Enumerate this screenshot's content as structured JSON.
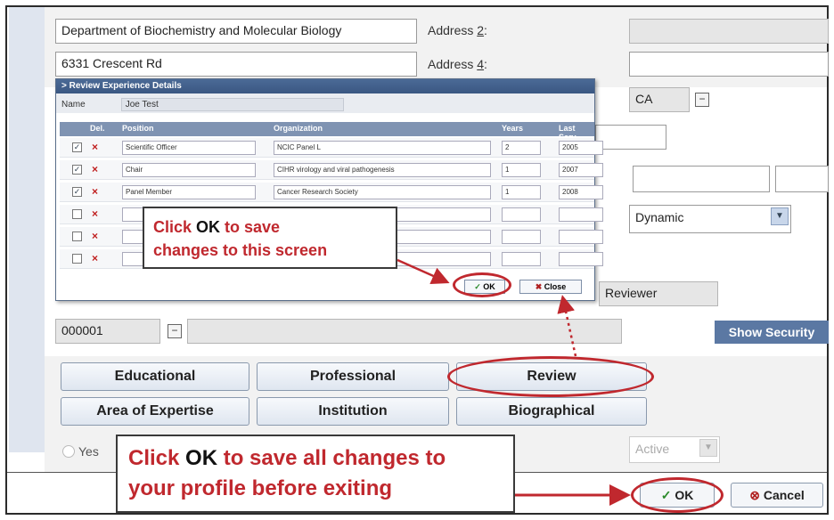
{
  "form": {
    "department": "Department of Biochemistry and Molecular Biology",
    "street": "6331 Crescent Rd",
    "address2_label_text": "Address ",
    "address2_label_key": "2",
    "address2_colon": ":",
    "address4_label_text": "Address ",
    "address4_label_key": "4",
    "address4_colon": ":",
    "province": "CA",
    "dropdown_value": "Dynamic",
    "reviewer_field": "Reviewer",
    "id_value": "000001",
    "show_security": "Show Security",
    "yes_label": "Yes",
    "status_value": "Active"
  },
  "tabs": {
    "educational": "Educational",
    "professional": "Professional",
    "review": "Review",
    "area": "Area of Expertise",
    "institution": "Institution",
    "biographical": "Biographical"
  },
  "popup": {
    "title": "Review Experience Details",
    "name_label": "Name",
    "name_value": "Joe Test",
    "headers": {
      "del": "Del.",
      "position": "Position",
      "organization": "Organization",
      "years": "Years",
      "last": "Last Serv"
    },
    "rows": [
      {
        "checked": "✓",
        "position": "Scientific Officer",
        "organization": "NCIC Panel L",
        "years": "2",
        "last": "2005"
      },
      {
        "checked": "✓",
        "position": "Chair",
        "organization": "CIHR virology and viral pathogenesis",
        "years": "1",
        "last": "2007"
      },
      {
        "checked": "✓",
        "position": "Panel Member",
        "organization": "Cancer Research Society",
        "years": "1",
        "last": "2008"
      },
      {
        "checked": "",
        "position": "",
        "organization": "",
        "years": "",
        "last": ""
      },
      {
        "checked": "",
        "position": "",
        "organization": "",
        "years": "",
        "last": ""
      },
      {
        "checked": "",
        "position": "",
        "organization": "",
        "years": "",
        "last": ""
      }
    ],
    "ok_label": "OK",
    "close_label": "Close"
  },
  "callouts": {
    "popup_pre": "Click ",
    "popup_key": "OK",
    "popup_post1": " to save",
    "popup_line2": "changes to this screen",
    "main_pre": "Click ",
    "main_key": "OK",
    "main_post1": " to save all changes to",
    "main_line2": "your profile before exiting"
  },
  "footer": {
    "ok_label": "OK",
    "cancel_label": "Cancel"
  },
  "colors": {
    "callout_red": "#c0282e",
    "popup_title": "#3a5782",
    "band": "#dfe5ef"
  }
}
